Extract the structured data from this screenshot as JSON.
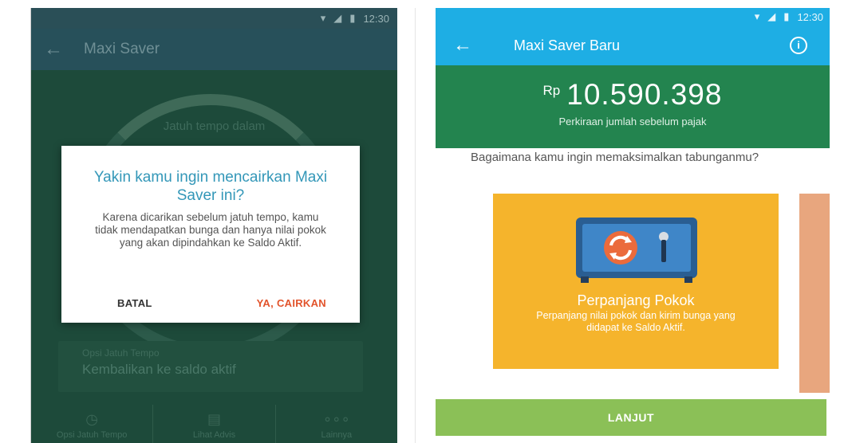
{
  "left_screen": {
    "status_time": "12:30",
    "title": "Maxi Saver",
    "due_label": "Jatuh tempo dalam",
    "option": {
      "label": "Opsi Jatuh Tempo",
      "value": "Kembalikan ke saldo aktif"
    },
    "bottom_nav": [
      {
        "label": "Opsi Jatuh Tempo",
        "icon": "clock-icon"
      },
      {
        "label": "Lihat Advis",
        "icon": "document-icon"
      },
      {
        "label": "Lainnya",
        "icon": "more-icon"
      }
    ],
    "dialog": {
      "title": "Yakin kamu ingin mencairkan Maxi Saver ini?",
      "body": "Karena dicarikan sebelum jatuh tempo, kamu tidak mendapatkan bunga dan hanya nilai pokok yang akan dipindahkan ke Saldo Aktif.",
      "cancel": "BATAL",
      "confirm": "YA, CAIRKAN"
    }
  },
  "right_screen": {
    "status_time": "12:30",
    "title": "Maxi Saver Baru",
    "currency": "Rp",
    "amount": "10.590.398",
    "amount_caption": "Perkiraan jumlah sebelum pajak",
    "question": "Bagaimana kamu ingin memaksimalkan tabunganmu?",
    "card": {
      "title": "Perpanjang Pokok",
      "description": "Perpanjang nilai pokok dan kirim bunga yang didapat ke Saldo Aktif."
    },
    "button": "LANJUT"
  },
  "colors": {
    "blue": "#1eaee4",
    "green": "#23844f",
    "card": "#f5b42c",
    "button": "#8bc057",
    "confirm": "#e2532b",
    "dialog_title": "#3397b8"
  }
}
